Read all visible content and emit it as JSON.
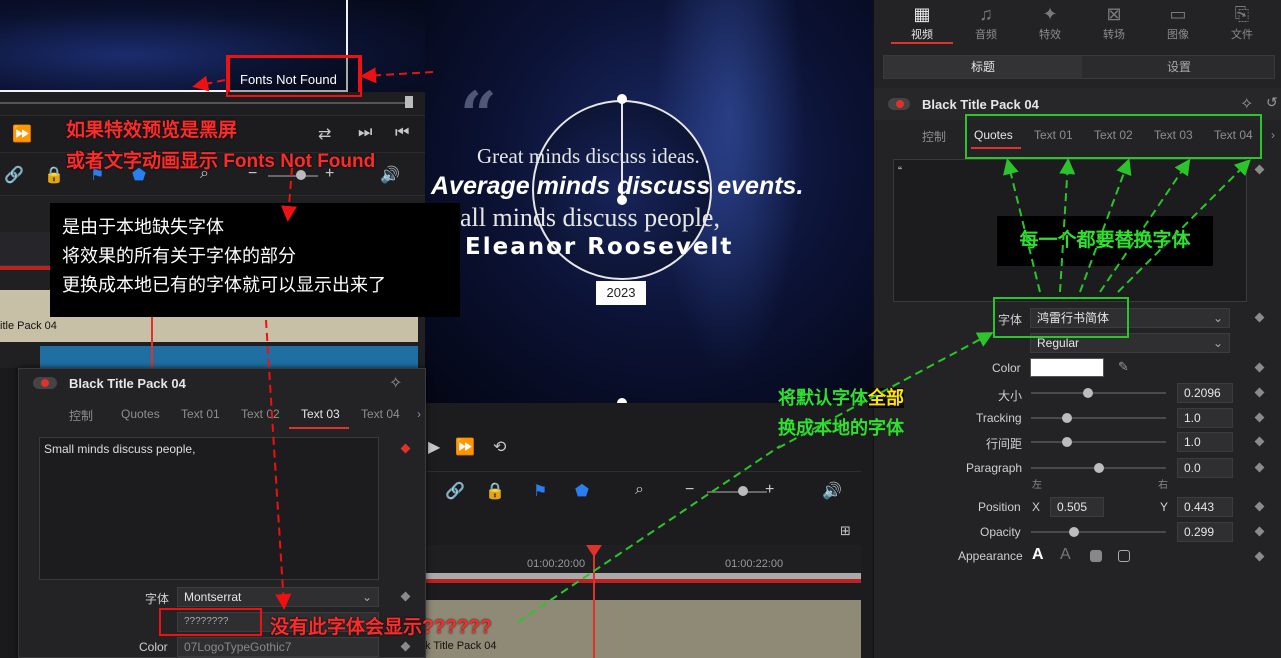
{
  "left_preview": {
    "fonts_not_found": "Fonts Not Found"
  },
  "center_preview": {
    "quote_mark": "“",
    "line1": "Great minds discuss ideas.",
    "line2": "Average minds discuss events.",
    "line3": "nall minds discuss people,",
    "line4": "Eleanor  Roosevelt",
    "year": "2023"
  },
  "center_timeline": {
    "tc1": "01:00:20:00",
    "tc2": "01:00:22:00",
    "clip_label": "k Title Pack 04"
  },
  "left_timeline": {
    "clip_label": "itle Pack 04"
  },
  "inspector": {
    "top_tabs": [
      "视频",
      "音频",
      "特效",
      "转场",
      "图像",
      "文件"
    ],
    "segments": [
      "标题",
      "设置"
    ],
    "title": "Black Title Pack 04",
    "sub_tabs": [
      "控制",
      "Quotes",
      "Text 01",
      "Text 02",
      "Text 03",
      "Text 04"
    ],
    "text_content": "“",
    "font_label": "字体",
    "font_value": "鸿雷行书简体",
    "style_value": "Regular",
    "color_label": "Color",
    "size_label": "大小",
    "size_value": "0.2096",
    "tracking_label": "Tracking",
    "tracking_value": "1.0",
    "line_spacing_label": "行间距",
    "line_spacing_value": "1.0",
    "paragraph_label": "Paragraph",
    "paragraph_value": "0.0",
    "align_left": "左",
    "align_right": "右",
    "position_label": "Position",
    "x_label": "X",
    "x_value": "0.505",
    "y_label": "Y",
    "y_value": "0.443",
    "opacity_label": "Opacity",
    "opacity_value": "0.299",
    "appearance_label": "Appearance"
  },
  "inset_inspector": {
    "title": "Black Title Pack 04",
    "sub_tabs": [
      "控制",
      "Quotes",
      "Text 01",
      "Text 02",
      "Text 03",
      "Text 04"
    ],
    "text_content": "Small minds discuss people,",
    "font_label": "字体",
    "font_value": "Montserrat",
    "style_value": "????????",
    "color_label": "Color",
    "color_value": "07LogoTypeGothic7"
  },
  "annotations": {
    "red1": "如果特效预览是黑屏",
    "red2": "或者文字动画显示 Fonts Not Found",
    "black1": "是由于本地缺失字体",
    "black2": "将效果的所有关于字体的部分",
    "black3": "更换成本地已有的字体就可以显示出来了",
    "green_box": "每一个都要替换字体",
    "green1_a": "将默认字体",
    "green1_b": "全部",
    "green2": "换成本地的字体",
    "red_bottom": "没有此字体会显示??????"
  },
  "colors": {
    "accent_red": "#e11111",
    "annotation_green": "#2bc52b",
    "playhead": "#e0322b"
  }
}
